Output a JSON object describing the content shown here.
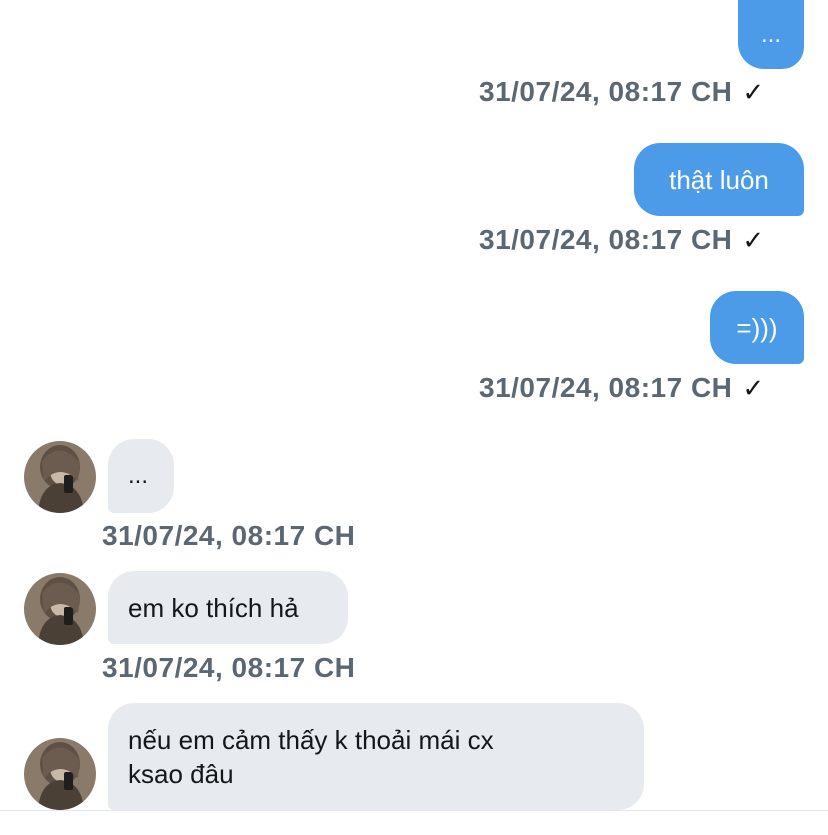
{
  "colors": {
    "outgoing_bubble": "#4c9be8",
    "incoming_bubble": "#e7eaee",
    "timestamp": "#5b6873"
  },
  "icons": {
    "sent": "check-icon",
    "avatar": "user-avatar"
  },
  "messages": [
    {
      "text": "...",
      "time": "31/07/24, 08:17 CH",
      "check": "✓"
    },
    {
      "text": "thật luôn",
      "time": "31/07/24, 08:17 CH",
      "check": "✓"
    },
    {
      "text": "=)))",
      "time": "31/07/24, 08:17 CH",
      "check": "✓"
    },
    {
      "text": "...",
      "time": "31/07/24, 08:17 CH"
    },
    {
      "text": "em ko thích hả",
      "time": "31/07/24, 08:17 CH"
    },
    {
      "line1": "nếu em cảm thấy k thoải mái cx",
      "line2": "ksao đâu"
    }
  ]
}
